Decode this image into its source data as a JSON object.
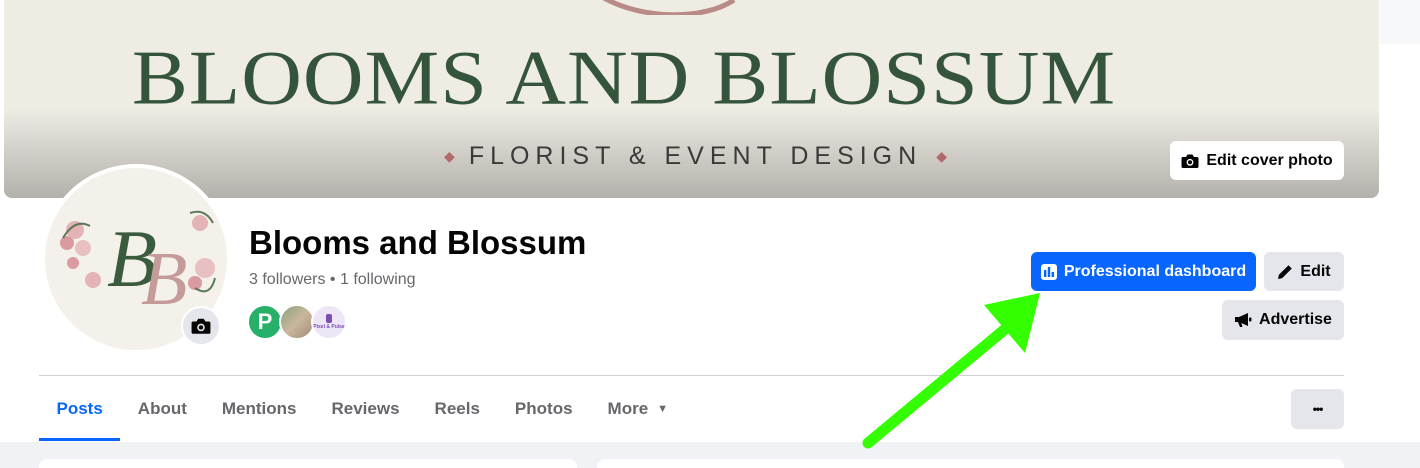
{
  "cover": {
    "brand_text": "BLOOMS AND BLOSSUM",
    "tagline": "FLORIST & EVENT DESIGN",
    "edit_cover_label": "Edit cover photo"
  },
  "profile": {
    "name": "Blooms and Blossum",
    "stats": "3 followers • 1 following",
    "avatar_monogram": "BB"
  },
  "follower_avatars": [
    {
      "name": "p-logo",
      "text": "P"
    },
    {
      "name": "person-photo",
      "text": ""
    },
    {
      "name": "pixel-pulse-logo",
      "text": "Pixel & Pulse"
    }
  ],
  "actions": {
    "professional_dashboard": "Professional dashboard",
    "edit": "Edit",
    "advertise": "Advertise"
  },
  "tabs": [
    {
      "label": "Posts",
      "active": true
    },
    {
      "label": "About",
      "active": false
    },
    {
      "label": "Mentions",
      "active": false
    },
    {
      "label": "Reviews",
      "active": false
    },
    {
      "label": "Reels",
      "active": false
    },
    {
      "label": "Photos",
      "active": false
    },
    {
      "label": "More",
      "active": false
    }
  ],
  "more_options_label": "•••",
  "colors": {
    "accent": "#0866ff",
    "arrow": "#33ff00",
    "brand_green": "#34553b"
  }
}
